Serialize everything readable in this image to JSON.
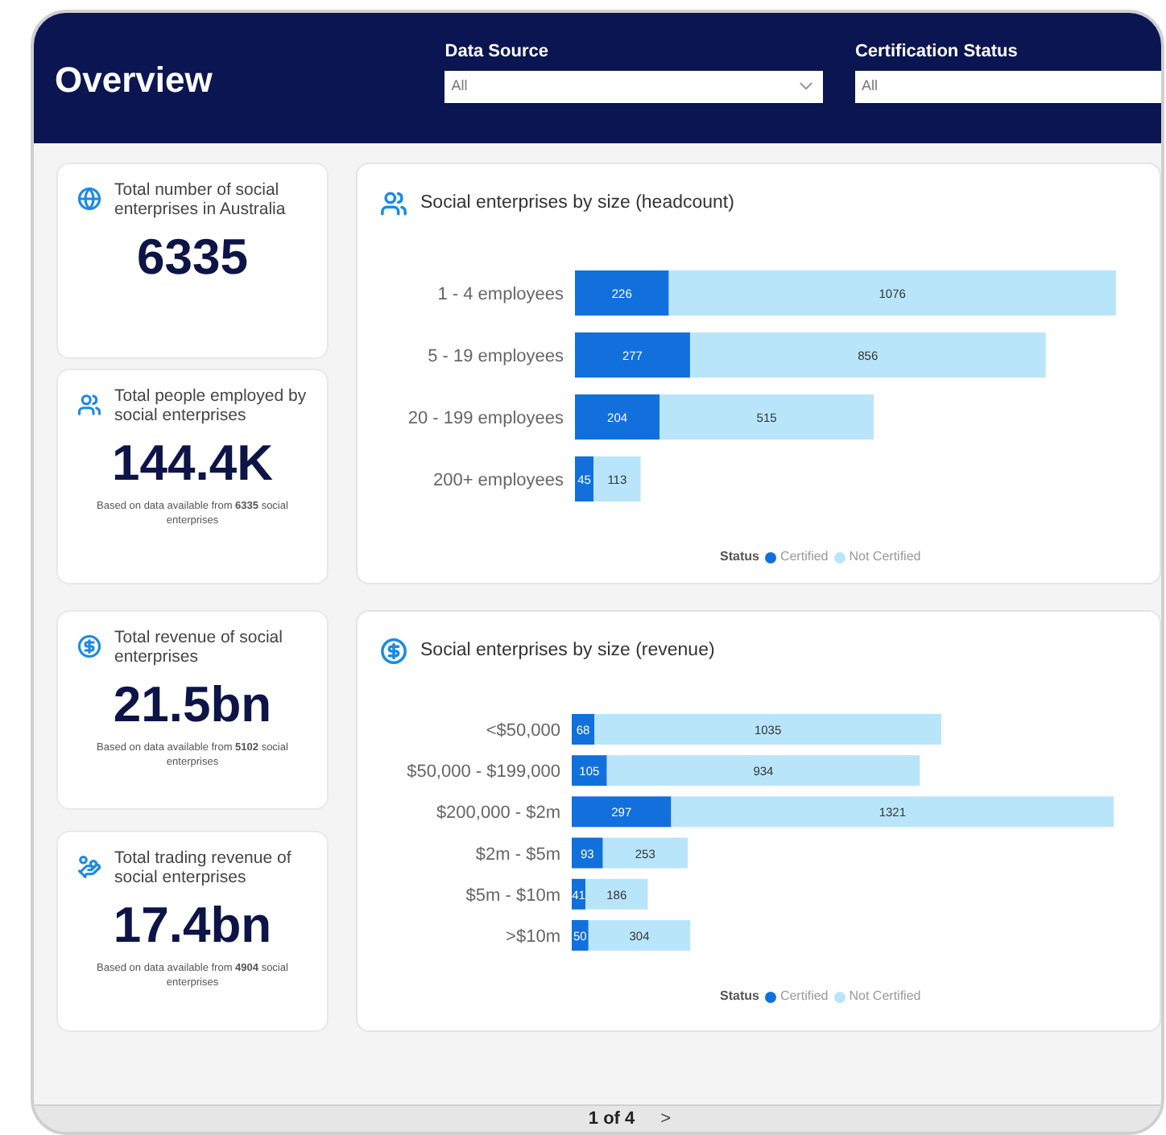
{
  "header": {
    "title": "Overview"
  },
  "filters": [
    {
      "label": "Data Source",
      "value": "All"
    },
    {
      "label": "Certification Status",
      "value": "All"
    }
  ],
  "kpis": [
    {
      "title": "Total number of social enterprises in Australia",
      "value": "6335"
    },
    {
      "title": "Total people employed by social enterprises",
      "value": "144.4K",
      "note": "Based on data available from **6335** social enterprises"
    },
    {
      "title": "Total revenue of social enterprises",
      "value": "21.5bn",
      "note": "Based on data available from **5102** social enterprises"
    },
    {
      "title": "Total trading revenue of social enterprises",
      "value": "17.4bn",
      "note": "Based on data available from **4904** social enterprises"
    }
  ],
  "charts": [
    {
      "legend_title": "Status",
      "chart_data": {
        "type": "bar",
        "title": "Social enterprises by size (headcount)",
        "orientation": "horizontal",
        "stacked": true,
        "data_labels": true,
        "categories": [
          "1 - 4 employees",
          "5 - 19 employees",
          "20 - 199 employees",
          "200+ employees"
        ],
        "series": [
          {
            "name": "Certified",
            "color": "#1170dc",
            "values": [
              226,
              277,
              204,
              45
            ]
          },
          {
            "name": "Not Certified",
            "color": "#b9e5fb",
            "values": [
              1076,
              856,
              515,
              113
            ]
          }
        ]
      }
    },
    {
      "legend_title": "Status",
      "chart_data": {
        "type": "bar",
        "title": "Social enterprises by size (revenue)",
        "orientation": "horizontal",
        "stacked": true,
        "data_labels": true,
        "categories": [
          "<$50,000",
          "$50,000 - $199,000",
          "$200,000 - $2m",
          "$2m - $5m",
          "$5m - $10m",
          ">$10m"
        ],
        "series": [
          {
            "name": "Certified",
            "color": "#1170dc",
            "values": [
              68,
              105,
              297,
              93,
              41,
              50
            ]
          },
          {
            "name": "Not Certified",
            "color": "#b9e5fb",
            "values": [
              1035,
              934,
              1321,
              253,
              186,
              304
            ]
          }
        ]
      }
    }
  ],
  "pager": {
    "label": "1 of 4",
    "next": ">"
  }
}
